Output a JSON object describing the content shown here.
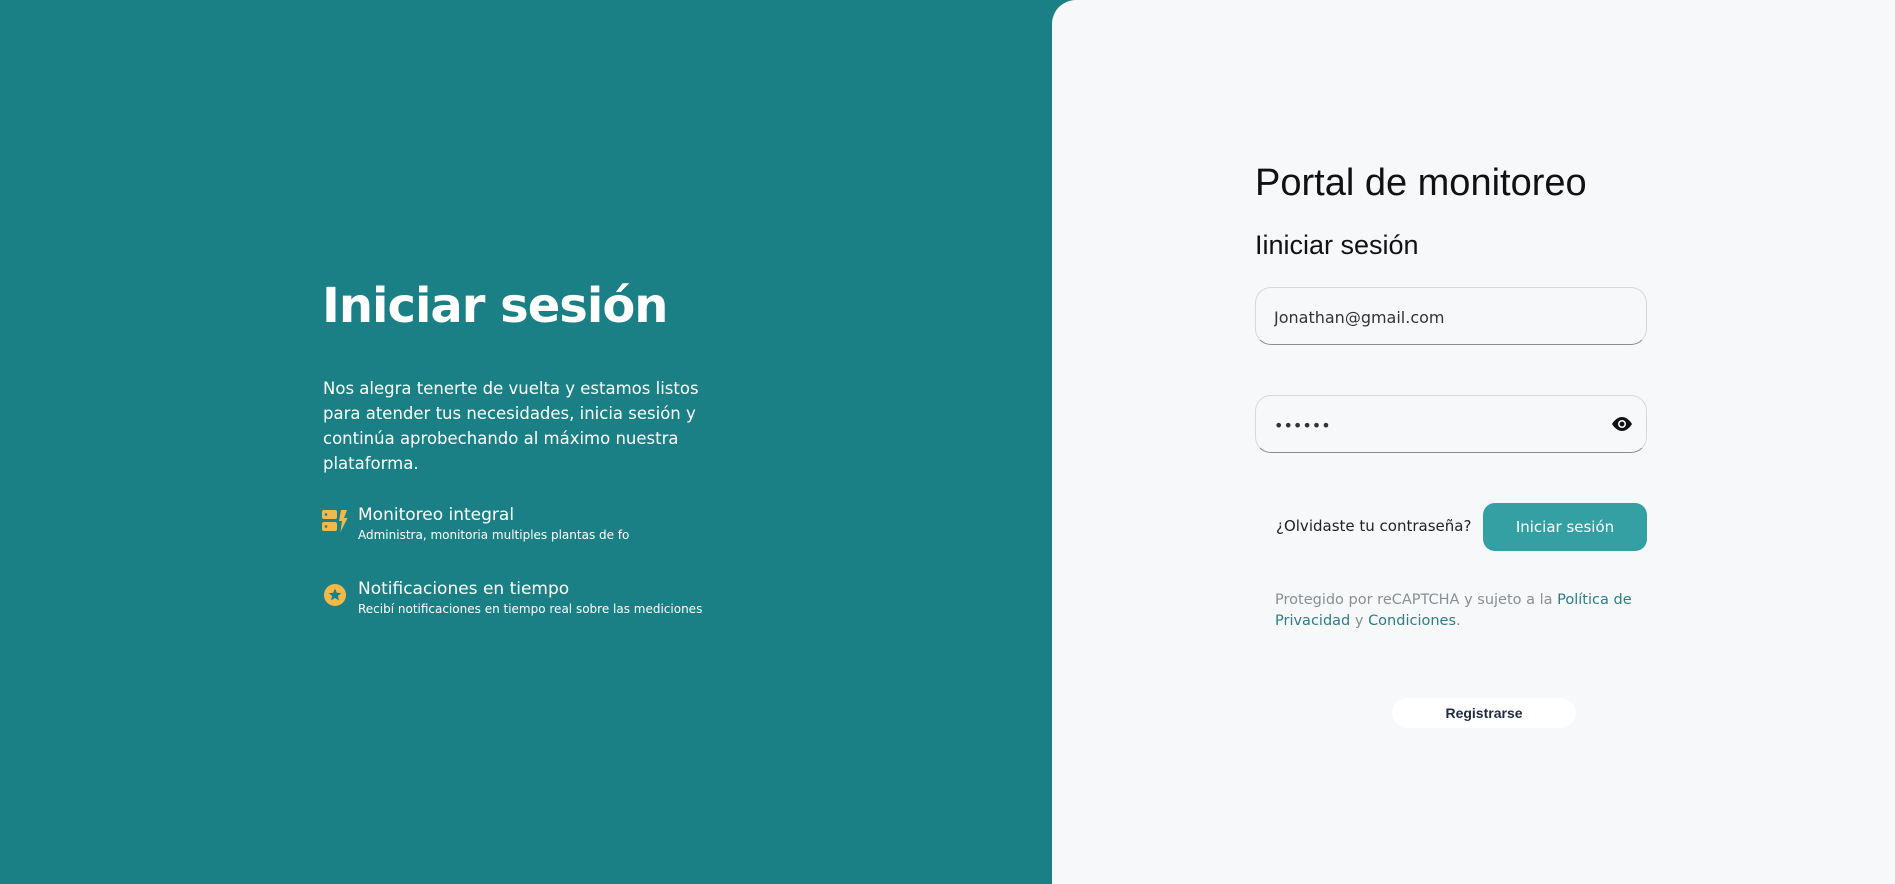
{
  "left": {
    "title": "Iniciar sesión",
    "intro": "Nos alegra tenerte de vuelta y estamos listos para atender tus necesidades, inicia sesión y continúa aprobechando al máximo nuestra plataforma.",
    "features": [
      {
        "icon": "server-bolt-icon",
        "title": "Monitoreo integral",
        "desc": "Administra, monitoria multiples plantas de fo"
      },
      {
        "icon": "star-badge-icon",
        "title": "Notificaciones en tiempo",
        "desc": "Recibí notificaciones en tiempo real sobre las mediciones"
      }
    ]
  },
  "form": {
    "title": "Portal de monitoreo",
    "subtitle": "Iiniciar sesión",
    "email_value": "Jonathan@gmail.com",
    "password_value": "••••••",
    "forgot_label": "¿Olvidaste tu contraseña?",
    "login_label": "Iniciar sesión",
    "legal_prefix": "Protegido por reCAPTCHA y sujeto a la ",
    "privacy_link": "Política de Privacidad",
    "legal_and": " y ",
    "terms_link": "Condiciones",
    "legal_end": ".",
    "register_label": "Registrarse"
  },
  "colors": {
    "brand": "#1b8085",
    "accent": "#34a0a4",
    "icon_yellow": "#f2b94a"
  }
}
